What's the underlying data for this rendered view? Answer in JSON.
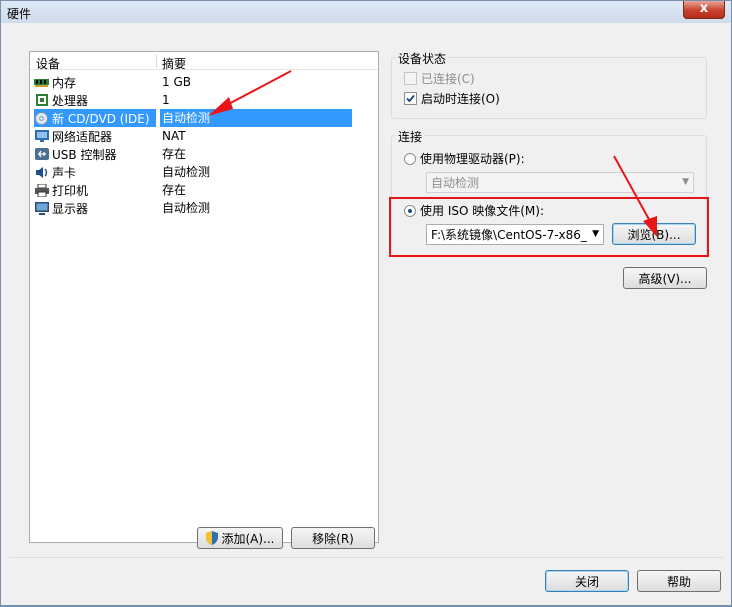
{
  "window": {
    "title": "硬件",
    "close_glyph": "x"
  },
  "device_list": {
    "col_device": "设备",
    "col_summary": "摘要",
    "rows": [
      {
        "name": "内存",
        "summary": "1 GB",
        "icon": "memory-icon"
      },
      {
        "name": "处理器",
        "summary": "1",
        "icon": "processor-icon"
      },
      {
        "name": "新 CD/DVD (IDE)",
        "summary": "自动检测",
        "icon": "cd-dvd-icon",
        "selected": true
      },
      {
        "name": "网络适配器",
        "summary": "NAT",
        "icon": "network-adapter-icon"
      },
      {
        "name": "USB 控制器",
        "summary": "存在",
        "icon": "usb-icon"
      },
      {
        "name": "声卡",
        "summary": "自动检测",
        "icon": "sound-icon"
      },
      {
        "name": "打印机",
        "summary": "存在",
        "icon": "printer-icon"
      },
      {
        "name": "显示器",
        "summary": "自动检测",
        "icon": "display-icon"
      }
    ],
    "add_label": "添加(A)...",
    "remove_label": "移除(R)"
  },
  "device_status": {
    "title": "设备状态",
    "connected_label": "已连接(C)",
    "connected_checked": false,
    "connect_on_power_label": "启动时连接(O)",
    "connect_on_power_checked": true
  },
  "connection": {
    "title": "连接",
    "physical_label": "使用物理驱动器(P):",
    "physical_value": "自动检测",
    "iso_label": "使用 ISO 映像文件(M):",
    "iso_value": "F:\\系统镜像\\CentOS-7-x86_",
    "browse_label": "浏览(B)...",
    "selected": "iso"
  },
  "advanced_label": "高级(V)...",
  "footer": {
    "close_label": "关闭",
    "help_label": "帮助"
  },
  "colors": {
    "selection": "#3399ff",
    "annotation": "#e8161a"
  }
}
